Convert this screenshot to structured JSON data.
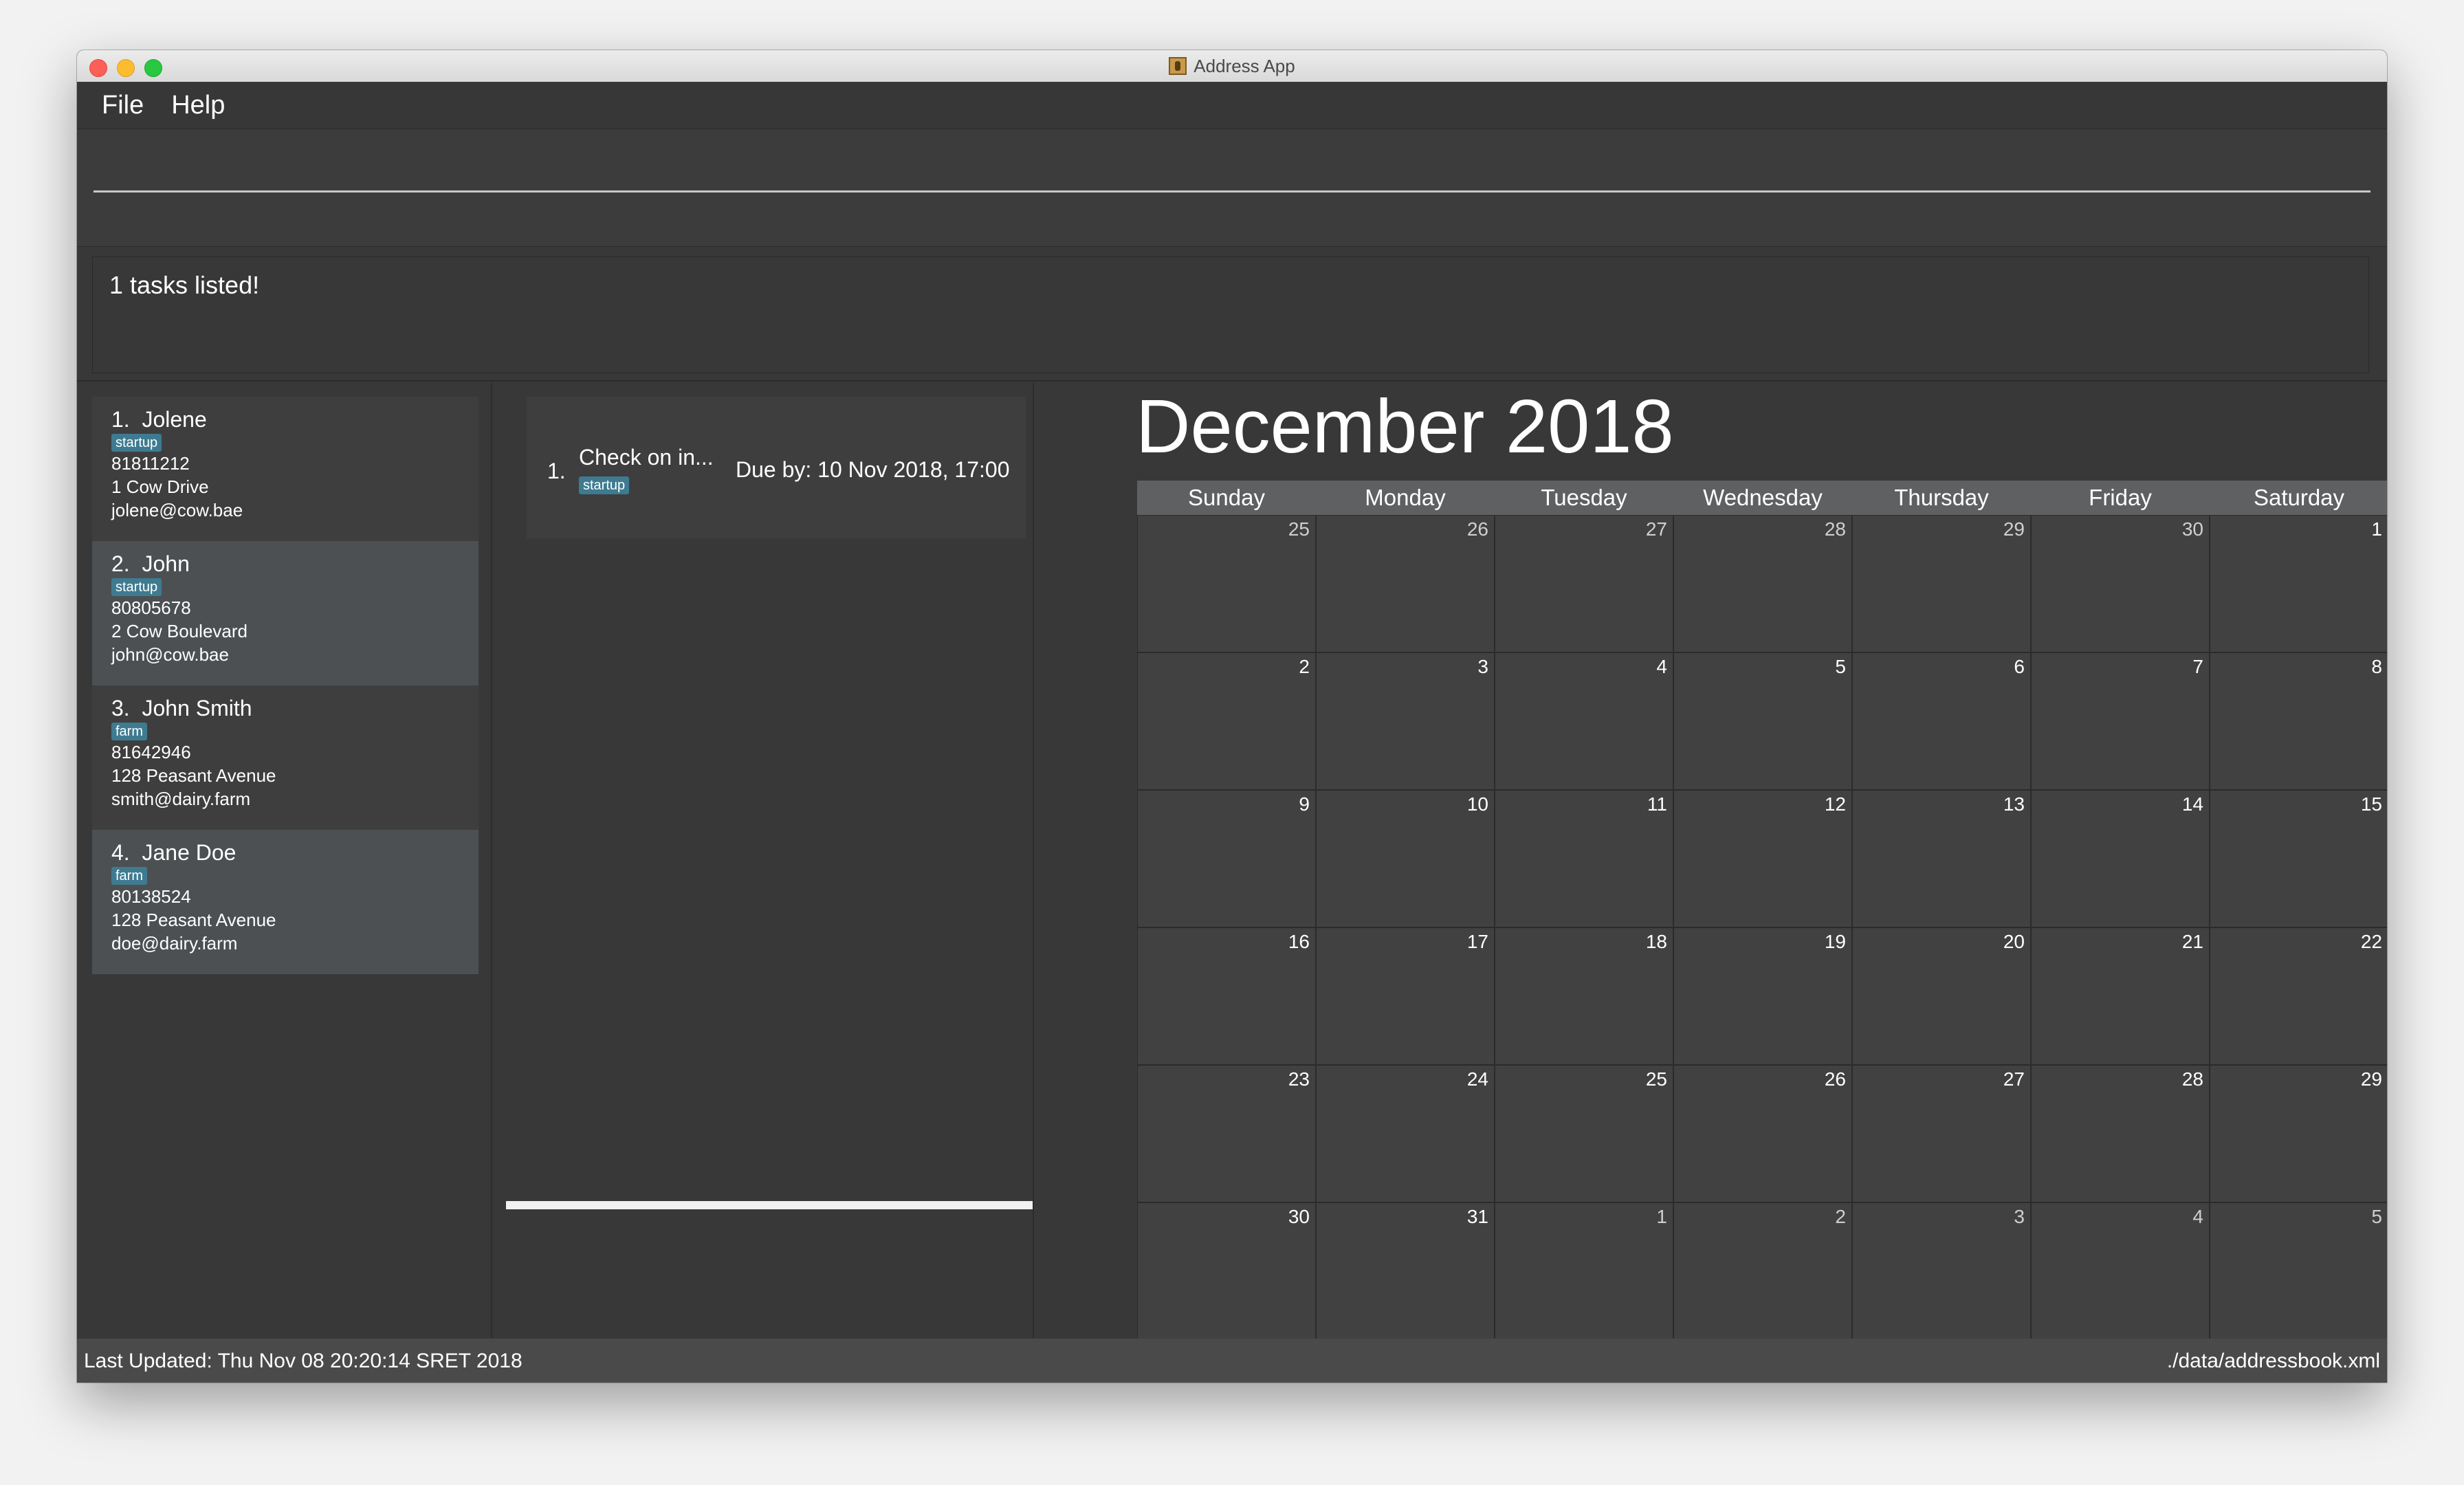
{
  "window": {
    "title": "Address App"
  },
  "menu": {
    "file": "File",
    "help": "Help"
  },
  "command": {
    "value": "",
    "placeholder": ""
  },
  "result": {
    "text": "1 tasks listed!"
  },
  "persons": [
    {
      "index": "1.",
      "name": "Jolene",
      "tag": "startup",
      "phone": "81811212",
      "address": "1 Cow Drive",
      "email": "jolene@cow.bae"
    },
    {
      "index": "2.",
      "name": "John",
      "tag": "startup",
      "phone": "80805678",
      "address": "2 Cow Boulevard",
      "email": "john@cow.bae"
    },
    {
      "index": "3.",
      "name": "John Smith",
      "tag": "farm",
      "phone": "81642946",
      "address": "128 Peasant Avenue",
      "email": "smith@dairy.farm"
    },
    {
      "index": "4.",
      "name": "Jane Doe",
      "tag": "farm",
      "phone": "80138524",
      "address": "128 Peasant Avenue",
      "email": "doe@dairy.farm"
    }
  ],
  "tasks": [
    {
      "index": "1.",
      "description": "Check on in...",
      "tag": "startup",
      "due": "Due by: 10 Nov 2018, 17:00"
    }
  ],
  "calendar": {
    "month_title": "December 2018",
    "days": [
      "Sunday",
      "Monday",
      "Tuesday",
      "Wednesday",
      "Thursday",
      "Friday",
      "Saturday"
    ],
    "weeks": [
      [
        "25",
        "26",
        "27",
        "28",
        "29",
        "30",
        "1"
      ],
      [
        "2",
        "3",
        "4",
        "5",
        "6",
        "7",
        "8"
      ],
      [
        "9",
        "10",
        "11",
        "12",
        "13",
        "14",
        "15"
      ],
      [
        "16",
        "17",
        "18",
        "19",
        "20",
        "21",
        "22"
      ],
      [
        "23",
        "24",
        "25",
        "26",
        "27",
        "28",
        "29"
      ],
      [
        "30",
        "31",
        "1",
        "2",
        "3",
        "4",
        "5"
      ]
    ]
  },
  "status": {
    "last_updated": "Last Updated: Thu Nov 08 20:20:14 SRET 2018",
    "file_path": "./data/addressbook.xml"
  }
}
